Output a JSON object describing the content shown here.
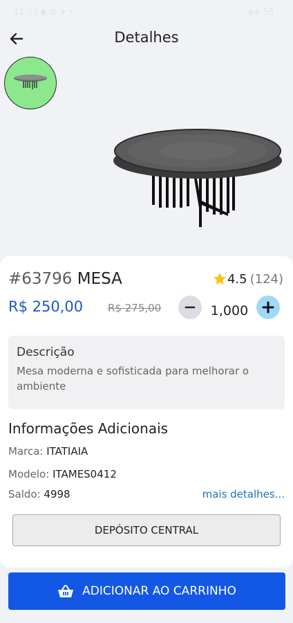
{
  "status_bar": {
    "left": "11:53 ◆ ⚙ ✦ •",
    "right": "◈◈ 58"
  },
  "header": {
    "title": "Detalhes"
  },
  "product": {
    "code": "#63796",
    "name": "MESA",
    "rating": "4.5",
    "reviews": "(124)",
    "price": "R$ 250,00",
    "old_price": "R$ 275,00",
    "quantity": "1,000"
  },
  "description": {
    "title": "Descrição",
    "text": "Mesa moderna e sofisticada para melhorar o ambiente"
  },
  "info": {
    "title": "Informações Adicionais",
    "brand_label": "Marca:",
    "brand_value": "ITATIAIA",
    "model_label": "Modelo:",
    "model_value": "ITAMES0412",
    "stock_label": "Saldo:",
    "stock_value": "4998",
    "more_link": "mais detalhes..."
  },
  "deposit_button": "DEPÓSITO CENTRAL",
  "add_to_cart_button": "ADICIONAR AO CARRINHO",
  "colors": {
    "accent": "#1357e5",
    "price": "#1f56c8",
    "thumb_bg": "#8be88d",
    "plus_bg": "#9fd9f6",
    "star": "#f5c518"
  },
  "icons": [
    "back-arrow-icon",
    "star-icon",
    "minus-icon",
    "plus-icon",
    "shopping-basket-icon"
  ]
}
